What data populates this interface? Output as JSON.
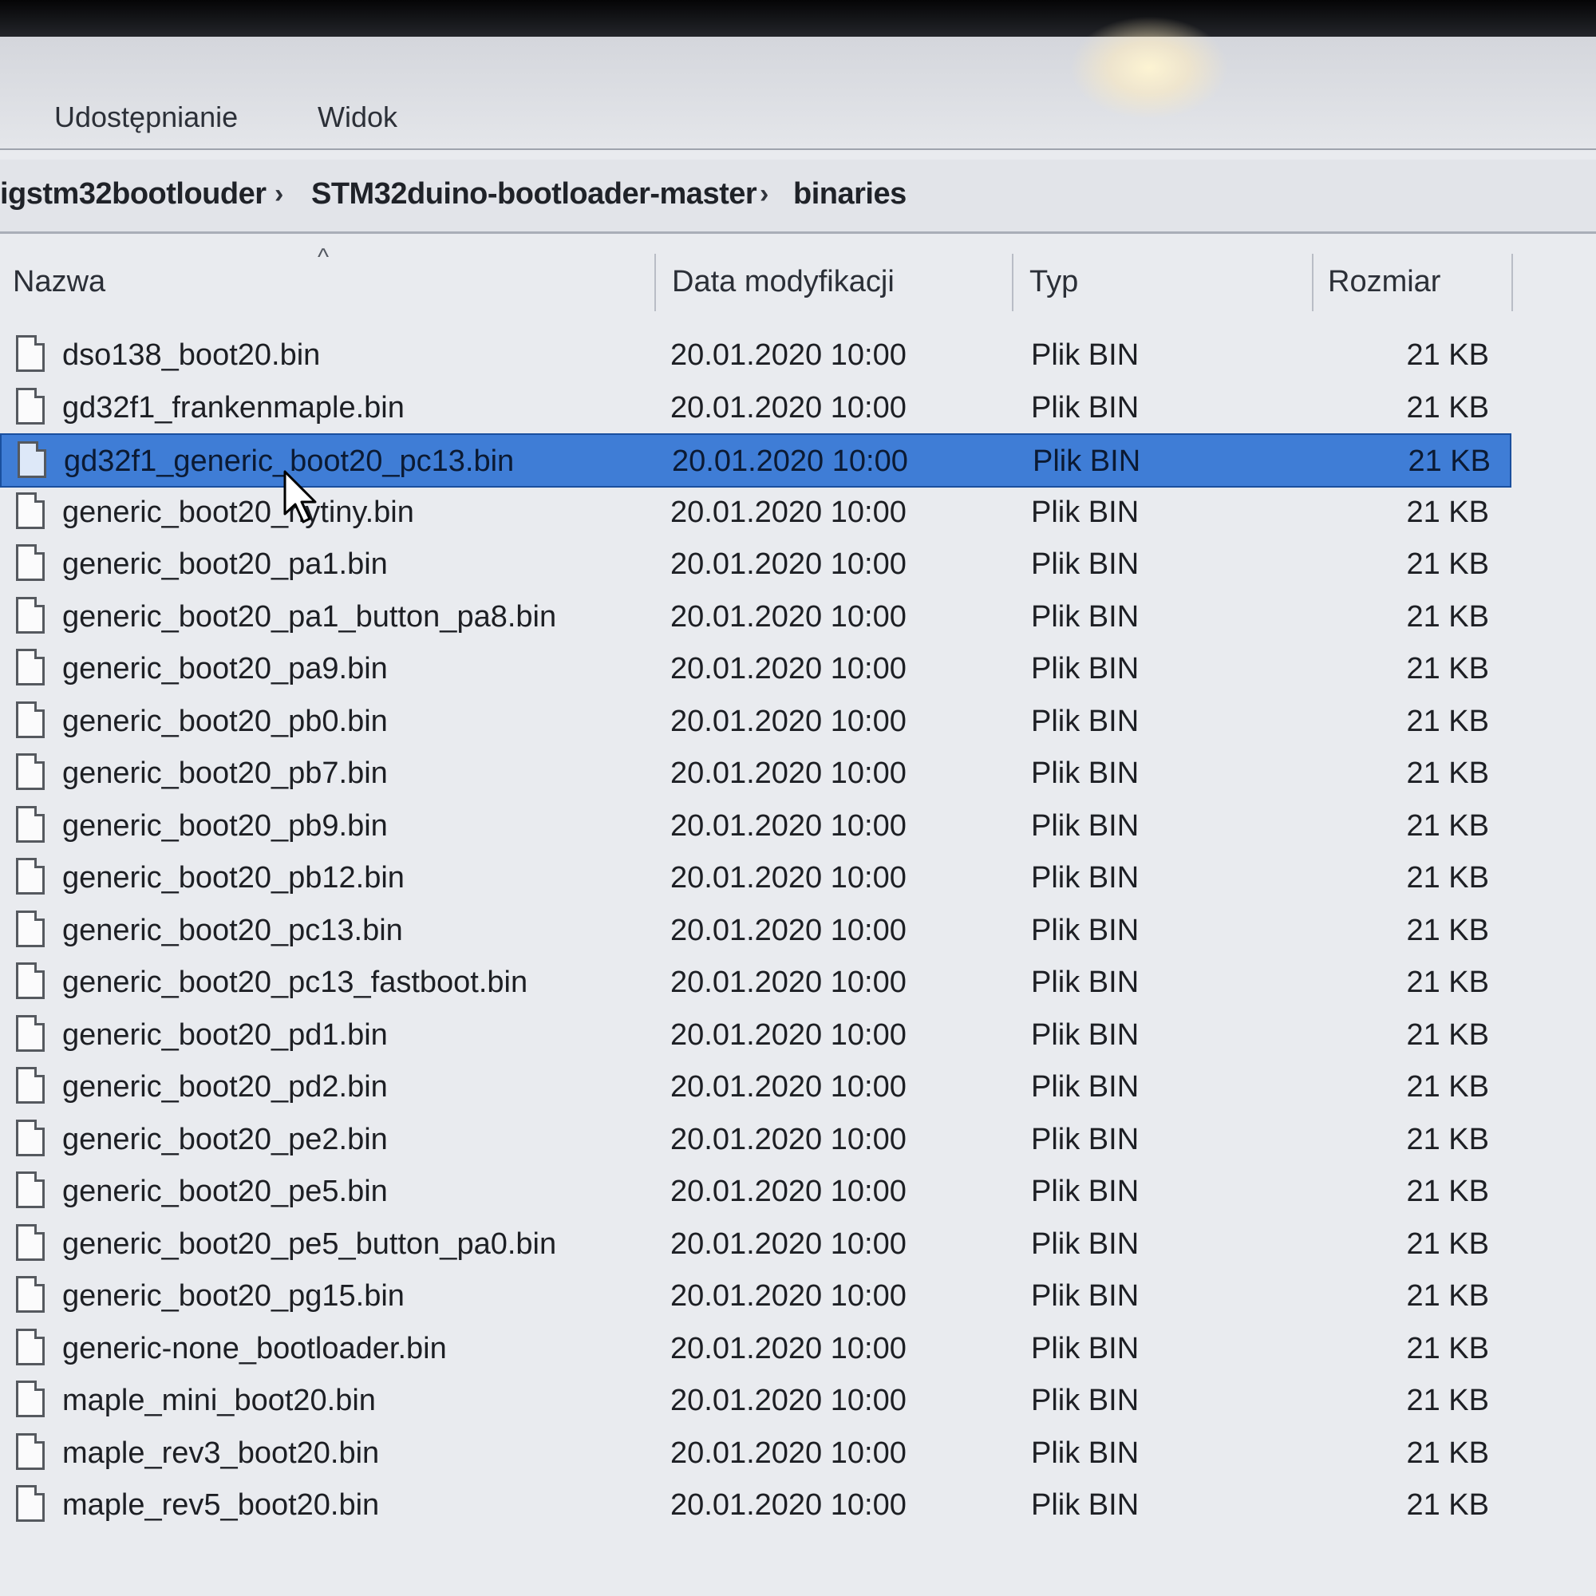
{
  "ribbon": {
    "tabs": [
      "Udostępnianie",
      "Widok"
    ]
  },
  "breadcrumb": {
    "items": [
      "igstm32bootlouder",
      "STM32duino-bootloader-master",
      "binaries"
    ],
    "separator": "›"
  },
  "columns": {
    "name": "Nazwa",
    "date": "Data modyfikacji",
    "type": "Typ",
    "size": "Rozmiar",
    "sort_indicator": "^"
  },
  "files": [
    {
      "name": "dso138_boot20.bin",
      "date": "20.01.2020 10:00",
      "type": "Plik BIN",
      "size": "21 KB"
    },
    {
      "name": "gd32f1_frankenmaple.bin",
      "date": "20.01.2020 10:00",
      "type": "Plik BIN",
      "size": "21 KB"
    },
    {
      "name": "gd32f1_generic_boot20_pc13.bin",
      "date": "20.01.2020 10:00",
      "type": "Plik BIN",
      "size": "21 KB"
    },
    {
      "name": "generic_boot20_hytiny.bin",
      "date": "20.01.2020 10:00",
      "type": "Plik BIN",
      "size": "21 KB"
    },
    {
      "name": "generic_boot20_pa1.bin",
      "date": "20.01.2020 10:00",
      "type": "Plik BIN",
      "size": "21 KB"
    },
    {
      "name": "generic_boot20_pa1_button_pa8.bin",
      "date": "20.01.2020 10:00",
      "type": "Plik BIN",
      "size": "21 KB"
    },
    {
      "name": "generic_boot20_pa9.bin",
      "date": "20.01.2020 10:00",
      "type": "Plik BIN",
      "size": "21 KB"
    },
    {
      "name": "generic_boot20_pb0.bin",
      "date": "20.01.2020 10:00",
      "type": "Plik BIN",
      "size": "21 KB"
    },
    {
      "name": "generic_boot20_pb7.bin",
      "date": "20.01.2020 10:00",
      "type": "Plik BIN",
      "size": "21 KB"
    },
    {
      "name": "generic_boot20_pb9.bin",
      "date": "20.01.2020 10:00",
      "type": "Plik BIN",
      "size": "21 KB"
    },
    {
      "name": "generic_boot20_pb12.bin",
      "date": "20.01.2020 10:00",
      "type": "Plik BIN",
      "size": "21 KB"
    },
    {
      "name": "generic_boot20_pc13.bin",
      "date": "20.01.2020 10:00",
      "type": "Plik BIN",
      "size": "21 KB"
    },
    {
      "name": "generic_boot20_pc13_fastboot.bin",
      "date": "20.01.2020 10:00",
      "type": "Plik BIN",
      "size": "21 KB"
    },
    {
      "name": "generic_boot20_pd1.bin",
      "date": "20.01.2020 10:00",
      "type": "Plik BIN",
      "size": "21 KB"
    },
    {
      "name": "generic_boot20_pd2.bin",
      "date": "20.01.2020 10:00",
      "type": "Plik BIN",
      "size": "21 KB"
    },
    {
      "name": "generic_boot20_pe2.bin",
      "date": "20.01.2020 10:00",
      "type": "Plik BIN",
      "size": "21 KB"
    },
    {
      "name": "generic_boot20_pe5.bin",
      "date": "20.01.2020 10:00",
      "type": "Plik BIN",
      "size": "21 KB"
    },
    {
      "name": "generic_boot20_pe5_button_pa0.bin",
      "date": "20.01.2020 10:00",
      "type": "Plik BIN",
      "size": "21 KB"
    },
    {
      "name": "generic_boot20_pg15.bin",
      "date": "20.01.2020 10:00",
      "type": "Plik BIN",
      "size": "21 KB"
    },
    {
      "name": "generic-none_bootloader.bin",
      "date": "20.01.2020 10:00",
      "type": "Plik BIN",
      "size": "21 KB"
    },
    {
      "name": "maple_mini_boot20.bin",
      "date": "20.01.2020 10:00",
      "type": "Plik BIN",
      "size": "21 KB"
    },
    {
      "name": "maple_rev3_boot20.bin",
      "date": "20.01.2020 10:00",
      "type": "Plik BIN",
      "size": "21 KB"
    },
    {
      "name": "maple_rev5_boot20.bin",
      "date": "20.01.2020 10:00",
      "type": "Plik BIN",
      "size": "21 KB"
    }
  ],
  "selected_file": "gd32f1_generic_boot20_pc13.bin",
  "colors": {
    "selection": "#3f7dd6",
    "background": "#e9ebef"
  }
}
